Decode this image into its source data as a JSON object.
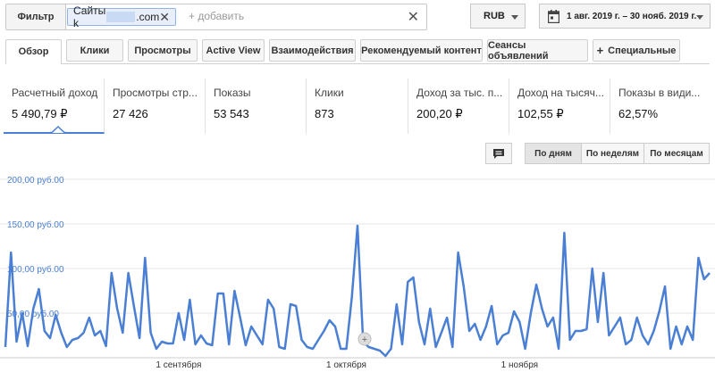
{
  "filter": {
    "button_label": "Фильтр",
    "chip_prefix": "Сайты k",
    "chip_suffix": ".com",
    "add_placeholder": "+ добавить"
  },
  "currency": {
    "value": "RUB"
  },
  "date_range": {
    "label": "1 авг. 2019 г. – 30 нояб. 2019 г."
  },
  "tabs": [
    {
      "label": "Обзор",
      "active": true
    },
    {
      "label": "Клики"
    },
    {
      "label": "Просмотры"
    },
    {
      "label": "Active View"
    },
    {
      "label": "Взаимодействия"
    },
    {
      "label": "Рекомендуемый контент"
    },
    {
      "label": "Сеансы объявлений"
    },
    {
      "label": "Специальные",
      "icon": "plus-icon"
    }
  ],
  "metrics": [
    {
      "label": "Расчетный доход",
      "value": "5 490,79 ₽",
      "selected": true
    },
    {
      "label": "Просмотры стр...",
      "value": "27 426"
    },
    {
      "label": "Показы",
      "value": "53 543"
    },
    {
      "label": "Клики",
      "value": "873"
    },
    {
      "label": "Доход за тыс. п...",
      "value": "200,20 ₽"
    },
    {
      "label": "Доход на тысяч...",
      "value": "102,55 ₽"
    },
    {
      "label": "Показы в види...",
      "value": "62,57%"
    }
  ],
  "period": {
    "day": "По дням",
    "week": "По неделям",
    "month": "По месяцам",
    "active": "day"
  },
  "colors": {
    "accent": "#4a7fd4",
    "line": "#4a7fd4"
  },
  "chart_data": {
    "type": "line",
    "y_ticks": [
      "50,00 руб.00",
      "100,00 руб.00",
      "150,00 руб.00",
      "200,00 руб.00"
    ],
    "x_ticks": [
      "1 сентября",
      "1 октября",
      "1 ноября"
    ],
    "ylim": [
      0,
      200
    ],
    "grid": true,
    "series": [
      {
        "values": [
          12,
          118,
          18,
          50,
          13,
          55,
          77,
          30,
          22,
          48,
          28,
          12,
          20,
          22,
          28,
          45,
          25,
          30,
          13,
          95,
          55,
          28,
          95,
          58,
          22,
          112,
          28,
          10,
          18,
          16,
          16,
          50,
          20,
          65,
          15,
          25,
          16,
          14,
          72,
          72,
          15,
          75,
          45,
          14,
          35,
          25,
          15,
          65,
          55,
          12,
          10,
          60,
          58,
          20,
          12,
          10,
          20,
          30,
          42,
          35,
          10,
          10,
          68,
          148,
          18,
          12,
          10,
          8,
          2,
          10,
          60,
          15,
          85,
          90,
          40,
          15,
          55,
          12,
          28,
          45,
          12,
          118,
          80,
          30,
          38,
          20,
          35,
          58,
          15,
          25,
          28,
          52,
          40,
          10,
          50,
          82,
          55,
          35,
          45,
          10,
          140,
          20,
          30,
          30,
          32,
          100,
          40,
          95,
          25,
          35,
          45,
          15,
          20,
          45,
          25,
          15,
          30,
          52,
          80,
          10,
          35,
          15,
          35,
          20,
          112,
          88,
          95
        ]
      }
    ]
  }
}
